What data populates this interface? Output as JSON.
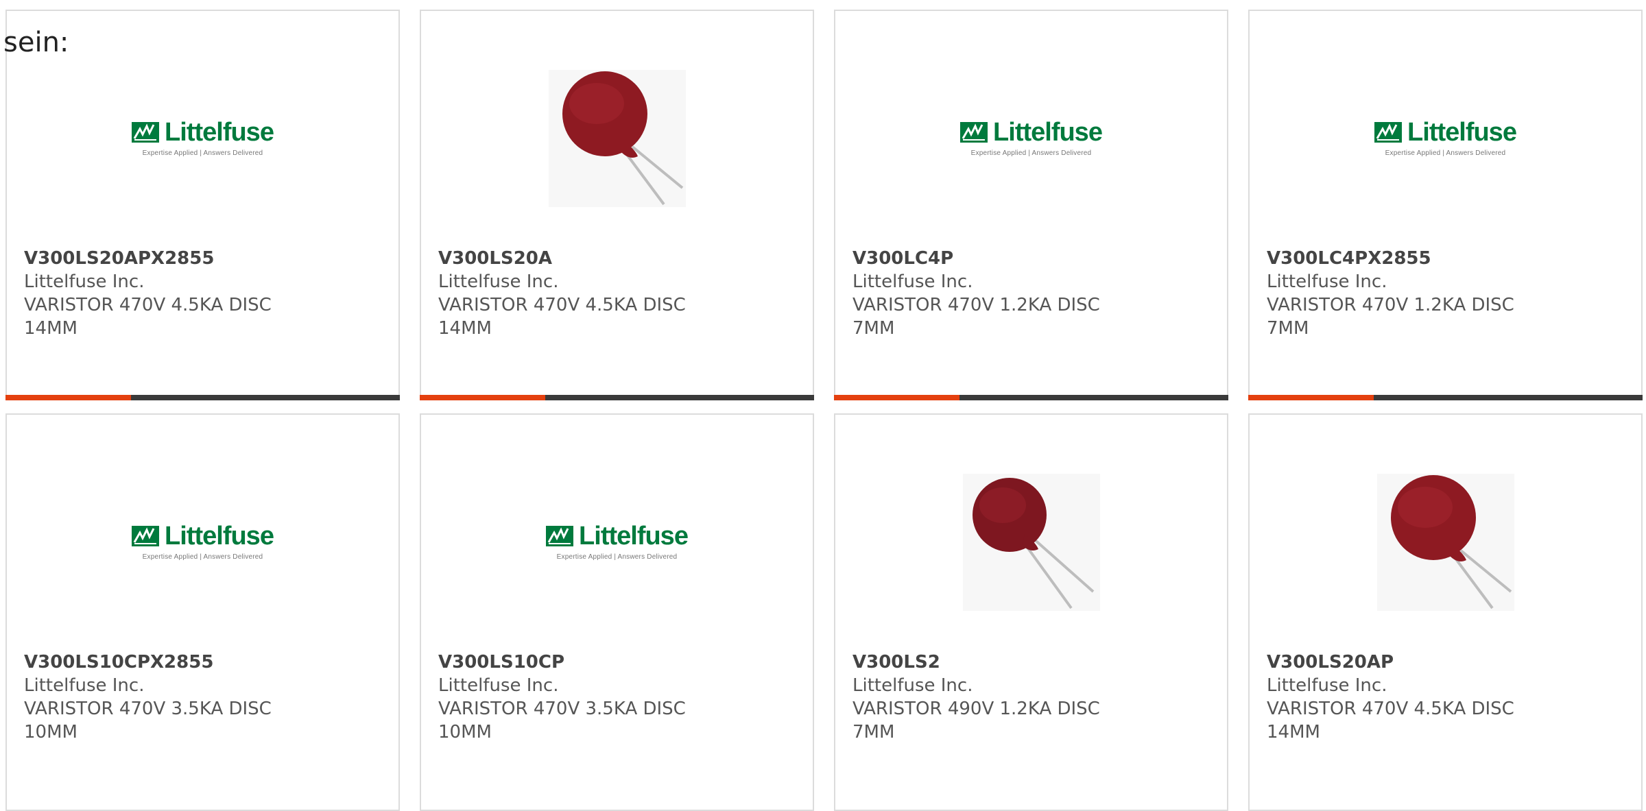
{
  "top_label": "sein:",
  "colors": {
    "brand_green": "#007a3d",
    "accent_orange": "#e4400f",
    "bar_dark": "#3a3a3a",
    "disc_red": "#8e1a22"
  },
  "logo": {
    "word": "Littelfuse",
    "tagline": "Expertise Applied | Answers Delivered"
  },
  "products": [
    {
      "part": "V300LS20APX2855",
      "mfr": "Littelfuse Inc.",
      "desc": "VARISTOR 470V 4.5KA DISC 14MM",
      "image": "littelfuse-logo"
    },
    {
      "part": "V300LS20A",
      "mfr": "Littelfuse Inc.",
      "desc": "VARISTOR 470V 4.5KA DISC 14MM",
      "image": "varistor-disc"
    },
    {
      "part": "V300LC4P",
      "mfr": "Littelfuse Inc.",
      "desc": "VARISTOR 470V 1.2KA DISC 7MM",
      "image": "littelfuse-logo"
    },
    {
      "part": "V300LC4PX2855",
      "mfr": "Littelfuse Inc.",
      "desc": "VARISTOR 470V 1.2KA DISC 7MM",
      "image": "littelfuse-logo"
    },
    {
      "part": "V300LS10CPX2855",
      "mfr": "Littelfuse Inc.",
      "desc": "VARISTOR 470V 3.5KA DISC 10MM",
      "image": "littelfuse-logo"
    },
    {
      "part": "V300LS10CP",
      "mfr": "Littelfuse Inc.",
      "desc": "VARISTOR 470V 3.5KA DISC 10MM",
      "image": "littelfuse-logo"
    },
    {
      "part": "V300LS2",
      "mfr": "Littelfuse Inc.",
      "desc": "VARISTOR 490V 1.2KA DISC 7MM",
      "image": "varistor-disc"
    },
    {
      "part": "V300LS20AP",
      "mfr": "Littelfuse Inc.",
      "desc": "VARISTOR 470V 4.5KA DISC 14MM",
      "image": "varistor-disc"
    }
  ]
}
